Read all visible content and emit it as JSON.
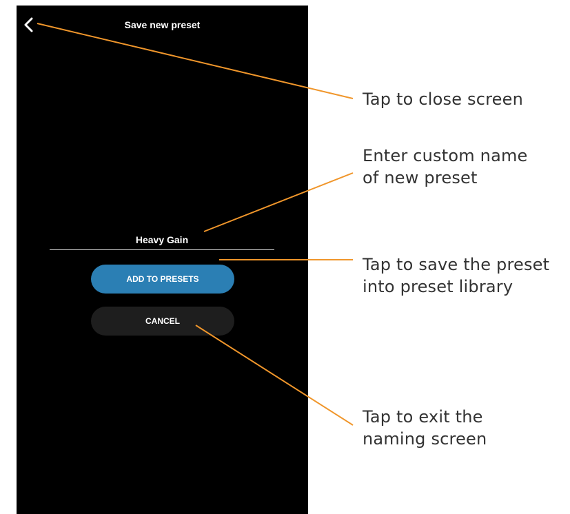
{
  "screen": {
    "title": "Save new preset",
    "back_icon": "chevron-left-icon"
  },
  "preset_name_field": {
    "value": "Heavy Gain"
  },
  "buttons": {
    "add_label": "ADD TO PRESETS",
    "cancel_label": "CANCEL"
  },
  "colors": {
    "screen_background": "#000000",
    "add_button": "#2b7fb4",
    "cancel_button": "#1e1e1e",
    "callout_line": "#f0962b"
  },
  "callouts": [
    {
      "lines": [
        "Tap to close screen"
      ]
    },
    {
      "lines": [
        "Enter custom name",
        "of new preset"
      ]
    },
    {
      "lines": [
        "Tap to save the preset",
        "into preset library"
      ]
    },
    {
      "lines": [
        "Tap to exit the",
        "naming screen"
      ]
    }
  ]
}
